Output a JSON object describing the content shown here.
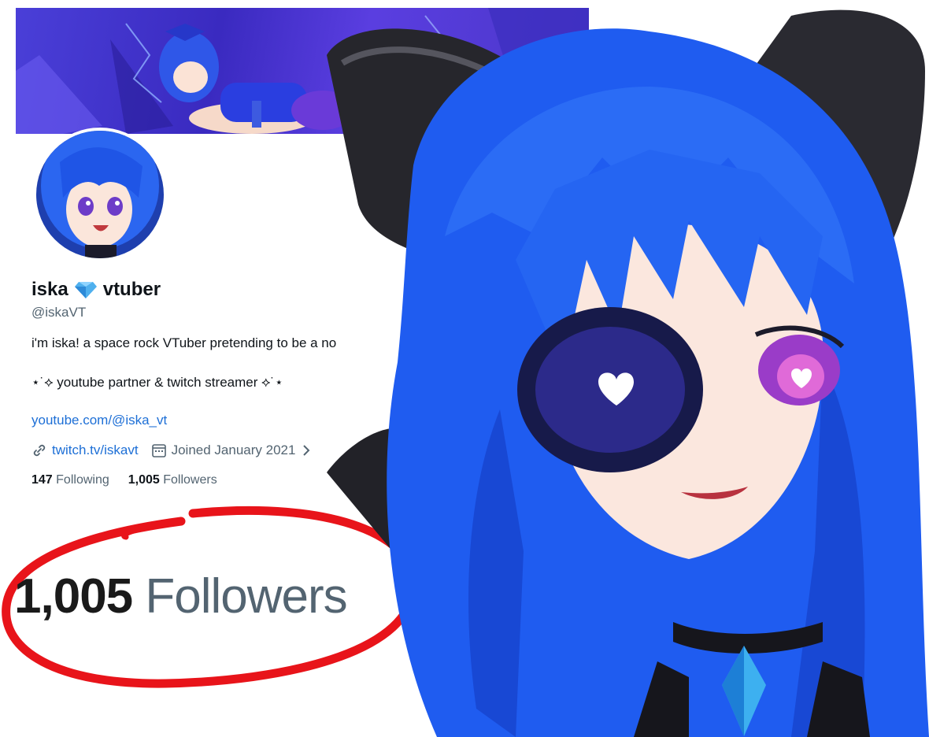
{
  "profile": {
    "name_part1": "iska",
    "name_part2": "vtuber",
    "handle": "@iskaVT",
    "bio_line1": "i'm iska! a space rock VTuber pretending to be a no",
    "bio_line2": "⋆˙⟡ youtube partner & twitch streamer ⟡˙⋆",
    "youtube_link": "youtube.com/@iska_vt",
    "twitch_link": "twitch.tv/iskavt",
    "joined": "Joined January 2021",
    "following_count": "147",
    "following_label": "Following",
    "followers_count": "1,005",
    "followers_label": "Followers"
  },
  "callout": {
    "count": "1,005",
    "label": "Followers"
  },
  "colors": {
    "banner": "#4a3fd8",
    "link": "#1d6fd6",
    "circle": "#e8141a",
    "hair": "#1f5cf0"
  },
  "icons": {
    "gem": "gem-icon",
    "link": "link-icon",
    "calendar": "calendar-icon",
    "chevron": "chevron-right-icon"
  }
}
